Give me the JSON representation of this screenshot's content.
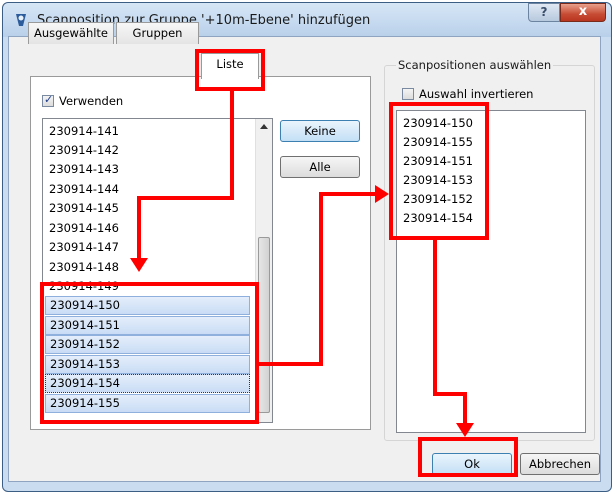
{
  "window": {
    "title": "Scanposition zur Gruppe '+10m-Ebene' hinzufügen",
    "help_label": "?",
    "close_label": "x"
  },
  "tabs": [
    {
      "label": "Ausgewählte"
    },
    {
      "label": "Gruppen"
    },
    {
      "label": "Liste"
    }
  ],
  "left_panel": {
    "use_checkbox_label": "Verwenden",
    "use_checked": true,
    "list_items": [
      "230914-141",
      "230914-142",
      "230914-143",
      "230914-144",
      "230914-145",
      "230914-146",
      "230914-147",
      "230914-148",
      "230914-149",
      "230914-150",
      "230914-151",
      "230914-152",
      "230914-153",
      "230914-154",
      "230914-155"
    ],
    "selected_items": [
      "230914-150",
      "230914-151",
      "230914-152",
      "230914-153",
      "230914-154",
      "230914-155"
    ],
    "buttons": {
      "none_label": "Keine",
      "all_label": "Alle"
    }
  },
  "right_panel": {
    "group_title": "Scanpositionen auswählen",
    "invert_checkbox_label": "Auswahl invertieren",
    "invert_checked": false,
    "list_items": [
      "230914-150",
      "230914-155",
      "230914-151",
      "230914-153",
      "230914-152",
      "230914-154"
    ]
  },
  "footer": {
    "ok_label": "Ok",
    "cancel_label": "Abbrechen"
  },
  "annotation_color": "#ff0000"
}
